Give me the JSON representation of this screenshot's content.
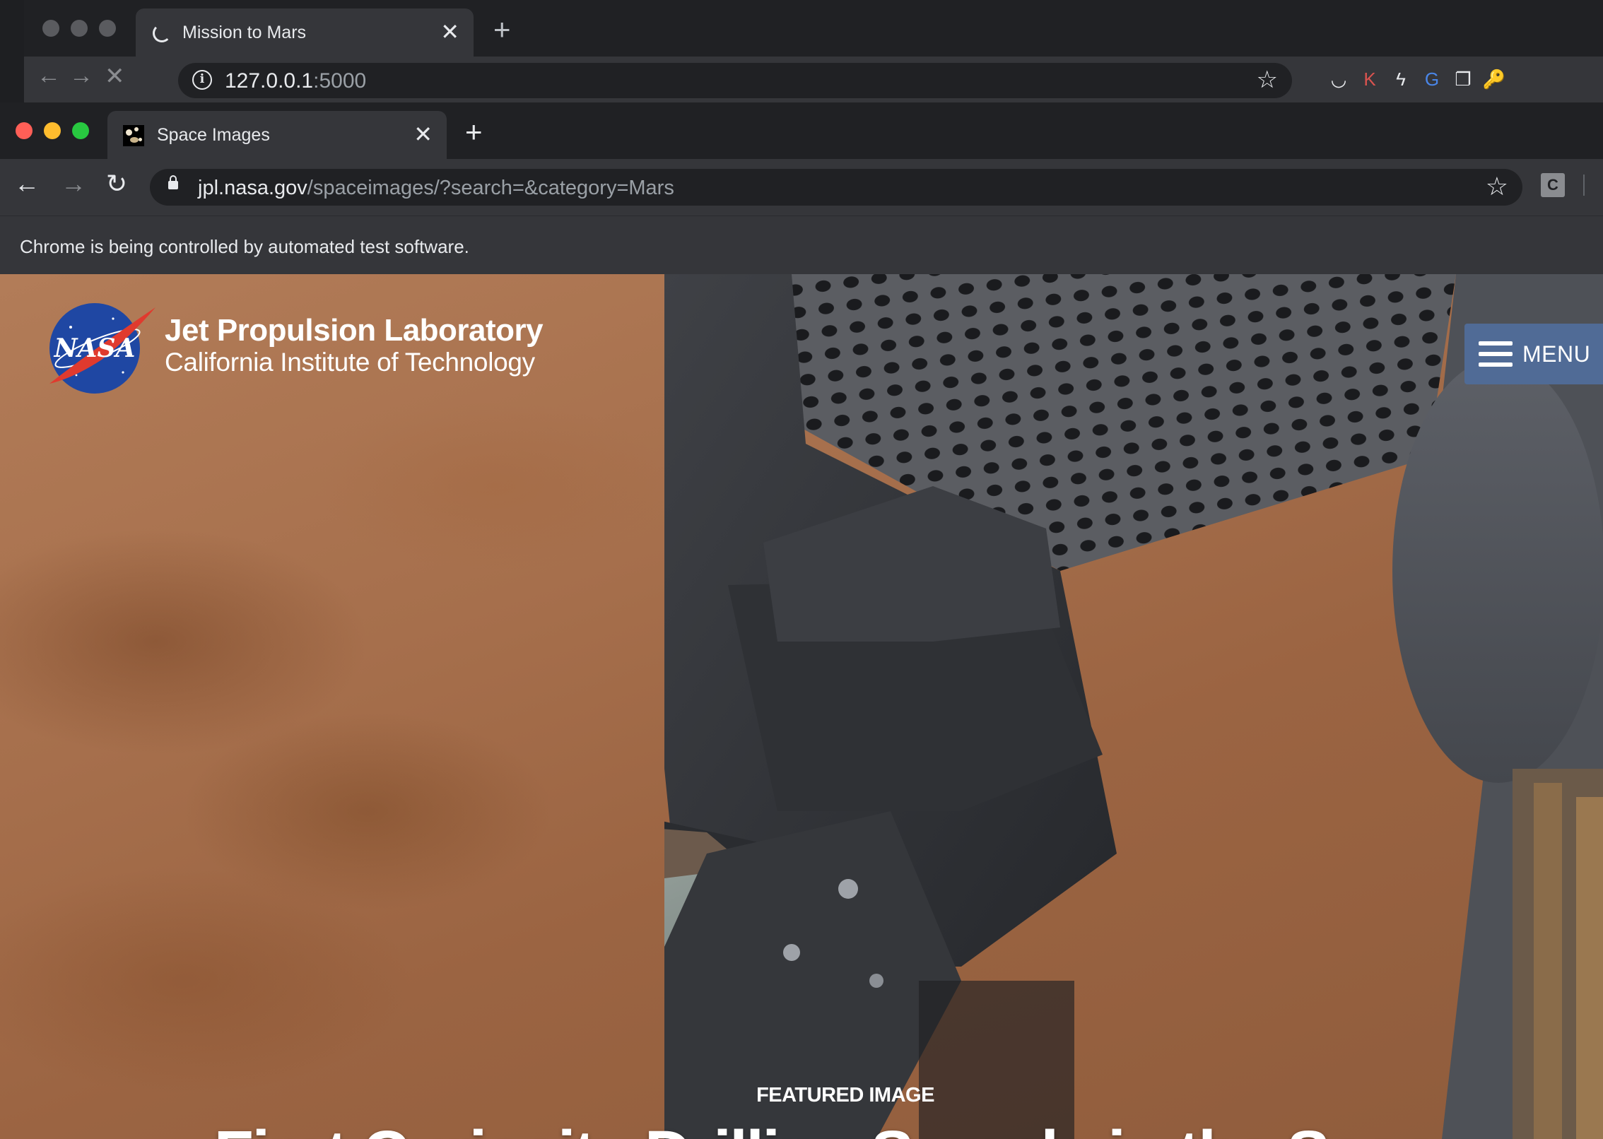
{
  "back_window": {
    "tab_title": "Mission to Mars",
    "url_host": "127.0.0.1",
    "url_rest": ":5000",
    "close_glyph": "✕",
    "new_tab_glyph": "+",
    "back_glyph": "←",
    "forward_glyph": "→",
    "stop_glyph": "✕",
    "info_glyph": "i",
    "star_glyph": "☆",
    "extensions": [
      {
        "name": "pocket-icon",
        "glyph": "◡",
        "color": "#e8eaed"
      },
      {
        "name": "k-extension-icon",
        "glyph": "K",
        "color": "#d9534f"
      },
      {
        "name": "lightning-extension-icon",
        "glyph": "ϟ",
        "color": "#e8eaed"
      },
      {
        "name": "google-translate-icon",
        "glyph": "G",
        "color": "#4a86e8"
      },
      {
        "name": "copy-extension-icon",
        "glyph": "❐",
        "color": "#e8eaed"
      },
      {
        "name": "key-extension-icon",
        "glyph": "🔑",
        "color": "#f4c430"
      }
    ]
  },
  "front_window": {
    "tab_title": "Space Images",
    "url_host": "jpl.nasa.gov",
    "url_rest": "/spaceimages/?search=&category=Mars",
    "close_glyph": "✕",
    "new_tab_glyph": "+",
    "back_glyph": "←",
    "forward_glyph": "→",
    "reload_glyph": "↻",
    "star_glyph": "☆",
    "extension_label": "C",
    "traffic_lights": {
      "close": "#ff5f57",
      "minimize": "#febc2e",
      "zoom": "#28c840"
    }
  },
  "infobar": {
    "message": "Chrome is being controlled by automated test software."
  },
  "page": {
    "logo_text": "NASA",
    "header_title": "Jet Propulsion Laboratory",
    "header_subtitle": "California Institute of Technology",
    "menu_label": "MENU",
    "featured_label": "FEATURED IMAGE",
    "featured_title": "First Curiosity Drilling Sample in the Scoop"
  }
}
